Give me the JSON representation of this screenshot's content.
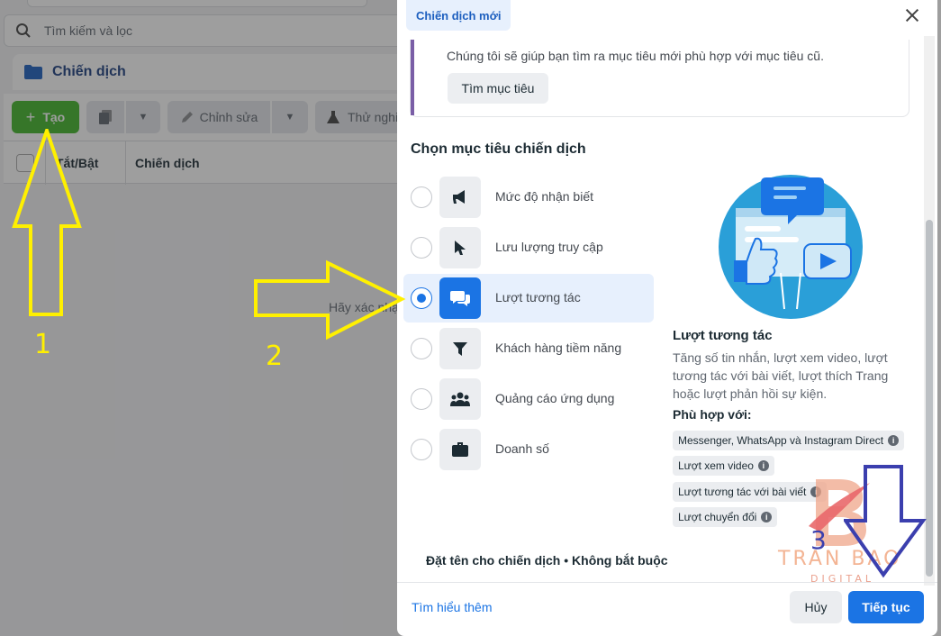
{
  "background": {
    "search_placeholder": "Tìm kiếm và lọc",
    "panel_title": "Chiến dịch",
    "toolbar": {
      "create": "Tạo",
      "edit": "Chỉnh sửa",
      "test": "Thử nghi"
    },
    "table": {
      "col_toggle": "Tắt/Bật",
      "col_campaign": "Chiến dịch"
    },
    "empty_text": "Hãy xác nhậ"
  },
  "modal": {
    "tab": "Chiến dịch mới",
    "hint": "Chúng tôi sẽ giúp bạn tìm ra mục tiêu mới phù hợp với mục tiêu cũ.",
    "find_button": "Tìm mục tiêu",
    "section_title": "Chọn mục tiêu chiến dịch",
    "options": [
      {
        "label": "Mức độ nhận biết",
        "icon": "megaphone-icon",
        "selected": false
      },
      {
        "label": "Lưu lượng truy cập",
        "icon": "cursor-icon",
        "selected": false
      },
      {
        "label": "Lượt tương tác",
        "icon": "chat-bubbles-icon",
        "selected": true
      },
      {
        "label": "Khách hàng tiềm năng",
        "icon": "funnel-icon",
        "selected": false
      },
      {
        "label": "Quảng cáo ứng dụng",
        "icon": "people-icon",
        "selected": false
      },
      {
        "label": "Doanh số",
        "icon": "briefcase-icon",
        "selected": false
      }
    ],
    "detail": {
      "title": "Lượt tương tác",
      "description": "Tăng số tin nhắn, lượt xem video, lượt tương tác với bài viết, lượt thích Trang hoặc lượt phản hồi sự kiện.",
      "fit_title": "Phù hợp với:",
      "chips": [
        "Messenger, WhatsApp và Instagram Direct",
        "Lượt xem video",
        "Lượt tương tác với bài viết",
        "Lượt chuyển đổi"
      ]
    },
    "name_label": "Đặt tên cho chiến dịch • Không bắt buộc",
    "learn_more": "Tìm hiểu thêm",
    "cancel": "Hủy",
    "continue": "Tiếp tục"
  },
  "annotations": {
    "step1": "1",
    "step2": "2",
    "step3": "3",
    "arrow_color": "#fff000",
    "arrow3_color": "#3b3fae"
  },
  "watermark": {
    "line1": "TRAN BAO",
    "line2": "DIGITAL"
  },
  "colors": {
    "primary": "#1b74e4",
    "create_green": "#42b72a"
  }
}
